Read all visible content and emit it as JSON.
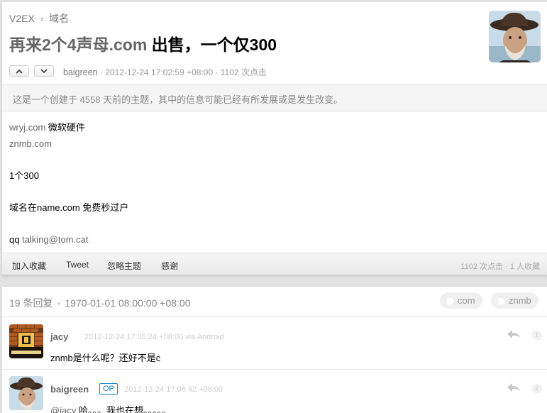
{
  "breadcrumb": {
    "site": "V2EX",
    "separator": "›",
    "node": "域名"
  },
  "topic": {
    "title_part1": "再来2个4声母.com",
    "title_part2": " 出售，一个仅300",
    "author": "baigreen",
    "meta_rest": " · 2012-12-24 17:02:59 +08:00 · 1102 次点击",
    "notice": "这是一个创建于 4558 天前的主题，其中的信息可能已经有所发展或是发生改变。",
    "content_lines": [
      {
        "a": "wryj.com",
        "b": " 微软硬件"
      },
      {
        "a": "znmb.com",
        "b": ""
      },
      {
        "a": "",
        "b": ""
      },
      {
        "a": "",
        "b": "1个300"
      },
      {
        "a": "",
        "b": ""
      },
      {
        "a": "",
        "b": "域名在name.com 免费秒过户"
      },
      {
        "a": "",
        "b": ""
      },
      {
        "a": "qq ",
        "b": "talking@tom.cat"
      }
    ],
    "actions": {
      "fav": "加入收藏",
      "tweet": "Tweet",
      "ignore": "忽略主题",
      "thanks": "感谢"
    },
    "stats": "1102 次点击 · 1 人收藏"
  },
  "replies_header": {
    "count": "19 条回复",
    "dot": "•",
    "time": "1970-01-01 08:00:00 +08:00",
    "tags": [
      "com",
      "znmb"
    ]
  },
  "replies": [
    {
      "user": "jacy",
      "time": "2012-12-24 17:05:24 +08:00 via Android",
      "mention": "",
      "text": "znmb是什么呢？还好不是c",
      "floor": "1",
      "op": ""
    },
    {
      "user": "baigreen",
      "time": "2012-12-24 17:06:42 +08:00",
      "mention": "@jacy",
      "text": " 哈。。。我也在想。。。。。",
      "floor": "2",
      "op": "OP"
    }
  ],
  "colors": {
    "accent": "#1484cd",
    "background": "#e2e2e2"
  }
}
